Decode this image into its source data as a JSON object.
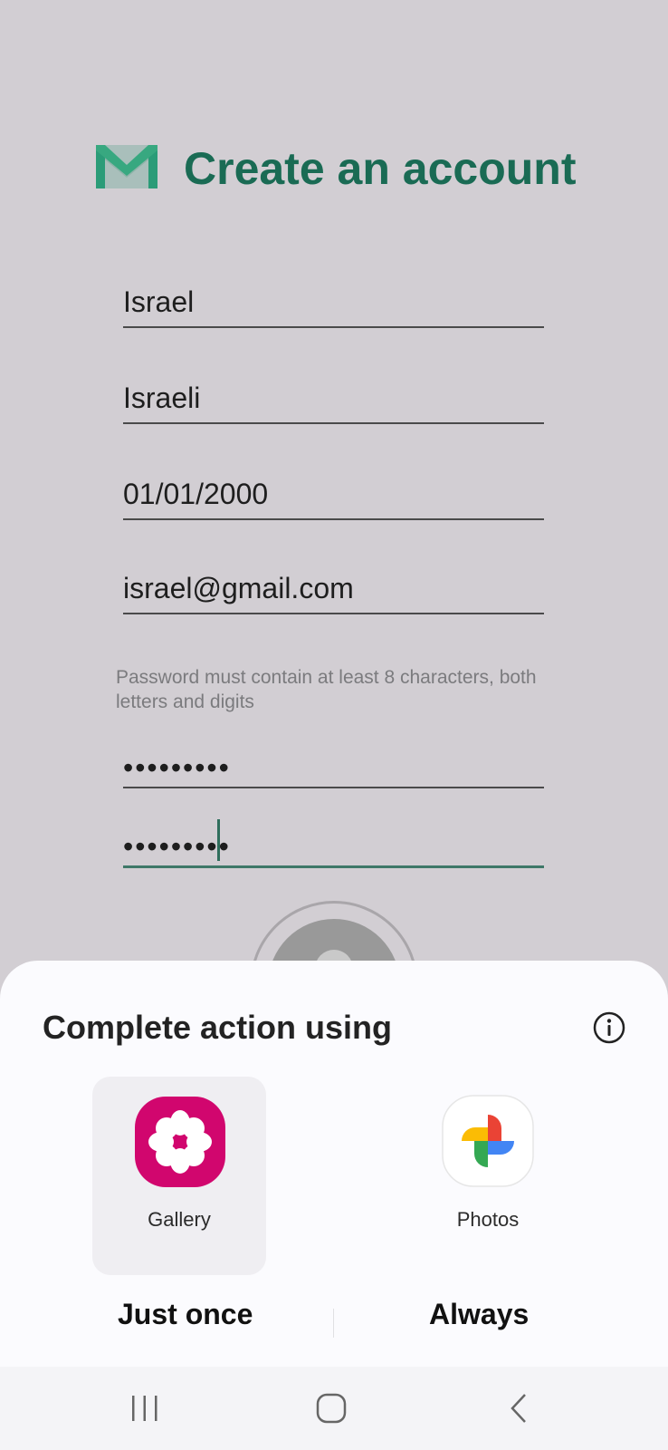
{
  "header": {
    "title": "Create an account",
    "logo_icon": "gmail-envelope-icon",
    "accent_color": "#1a6b54"
  },
  "form": {
    "first_name": "Israel",
    "last_name": "Israeli",
    "birth_date": "01/01/2000",
    "email": "israel@gmail.com",
    "password_hint": "Password must contain at least 8 characters, both letters and digits",
    "password": "•••••••••",
    "confirm_password": "•••••••••"
  },
  "sheet": {
    "title": "Complete action using",
    "info_icon": "info-icon",
    "options": [
      {
        "label": "Gallery",
        "icon": "gallery-flower-icon",
        "color": "#d1066e"
      },
      {
        "label": "Photos",
        "icon": "google-photos-pinwheel-icon"
      }
    ],
    "just_once": "Just once",
    "always": "Always"
  },
  "navbar": {
    "recents_icon": "recents-icon",
    "home_icon": "home-icon",
    "back_icon": "back-icon"
  }
}
